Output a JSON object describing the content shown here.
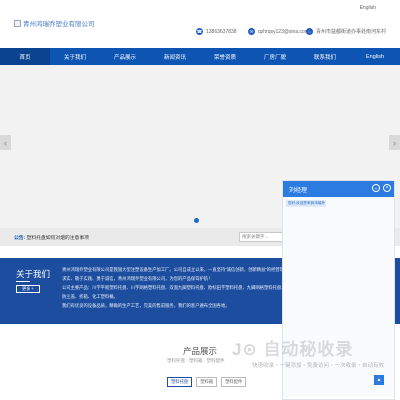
{
  "header": {
    "logo_alt": "青州鸿瑞乔塑业有限公司",
    "english_link": "English",
    "phone": "13863637838",
    "email": "qzhrqsy123@sina.com",
    "address": "青州市益都街道办事处南河东村"
  },
  "nav": {
    "items": [
      {
        "label": "首页"
      },
      {
        "label": "关于我们"
      },
      {
        "label": "产品展示"
      },
      {
        "label": "新闻资讯"
      },
      {
        "label": "荣誉资质"
      },
      {
        "label": "厂房厂貌"
      },
      {
        "label": "联系我们"
      },
      {
        "label": "English"
      }
    ]
  },
  "banner": {
    "prev": "‹",
    "next": "›"
  },
  "notice": {
    "prefix": "公告:",
    "text": "塑料托盘如何对烟的注意事项",
    "search_placeholder": "搜索关键字..."
  },
  "about": {
    "title": "关于我们",
    "more": "更多 +",
    "paragraphs": [
      "青州鸿瑞乔塑业有限公司是我国大型注塑设备生产加工厂。公司自成立以来，一直坚持“诚信创新，创新精益”的经营理念，以服务市场",
      "求实、敬于实践、勇于诚信，青州鸿瑞乔塑业有限公司，为您的产品保驾护航！",
      "公司主要产品：川字平板塑料托盘、川字网格塑料托盘、双面九脚塑料托盘、欧标田字塑料托盘、九脚网格塑料托盘、田字网格塑料托盘、",
      "防尘盖、折箱、化工塑料桶。",
      "我们有优良的设备品质，精确的生产工艺，完美的售前服务，我们的客户遍布全国各地。"
    ]
  },
  "products": {
    "title": "产品展示",
    "subtitle": "塑料托盘 · 塑料箱 · 塑料配件",
    "tabs": [
      {
        "label": "塑料托盘"
      },
      {
        "label": "塑料箱"
      },
      {
        "label": "塑料配件"
      }
    ]
  },
  "chat": {
    "agent_name": "刘经理",
    "greeting": "您好,欢迎您来到鸿瑞乔",
    "minimize": "⌄",
    "close": "×"
  },
  "watermark": {
    "brand": "自动秘收录",
    "slogan": "快速收录・一键添加・免费访问・一次收录・自动有效"
  },
  "scroll_top": "▲"
}
